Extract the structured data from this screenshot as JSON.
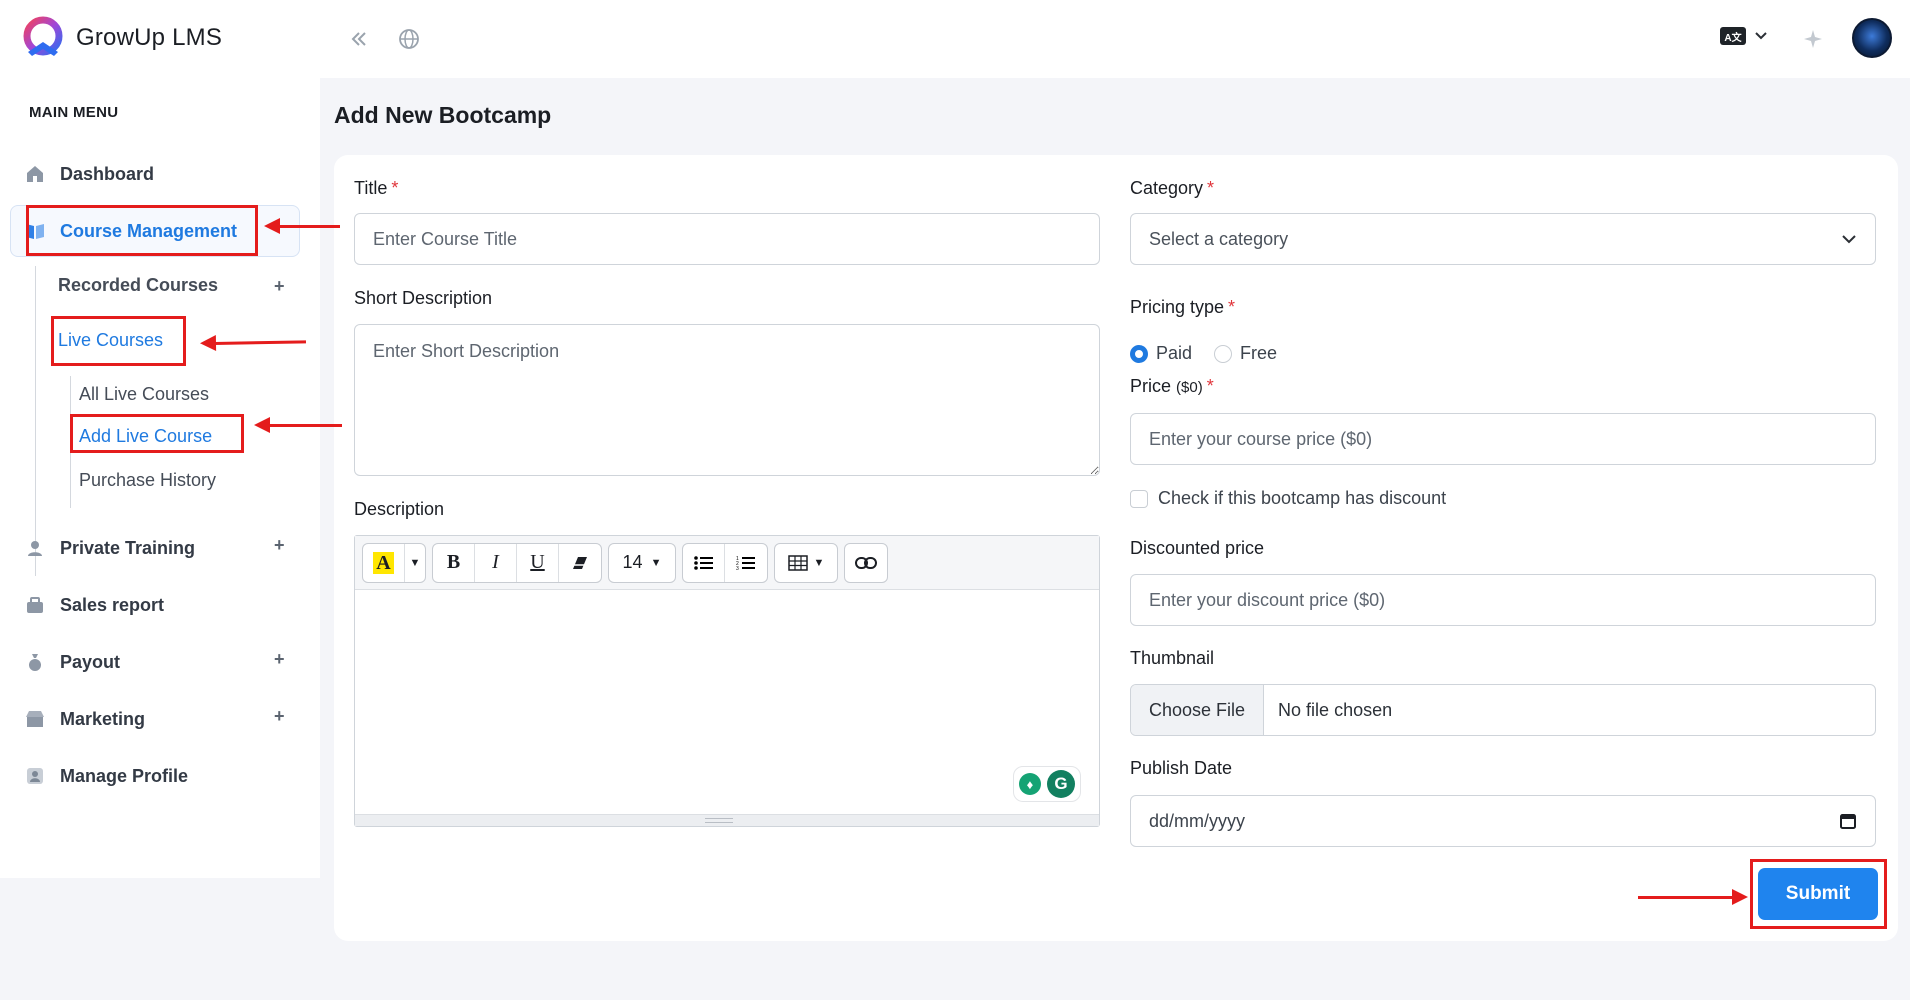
{
  "app": {
    "name": "GrowUp LMS"
  },
  "header": {
    "lang_badge": "A文"
  },
  "sidebar": {
    "menu_title": "MAIN MENU",
    "items": [
      {
        "label": "Dashboard"
      },
      {
        "label": "Course Management"
      },
      {
        "label": "Private Training",
        "expand": "+"
      },
      {
        "label": "Sales report"
      },
      {
        "label": "Payout",
        "expand": "+"
      },
      {
        "label": "Marketing",
        "expand": "+"
      },
      {
        "label": "Manage Profile"
      }
    ],
    "course_management": {
      "recorded_courses": "Recorded Courses",
      "recorded_expand": "+",
      "live_courses": "Live Courses",
      "live_children": [
        "All Live Courses",
        "Add Live Course",
        "Purchase History"
      ]
    }
  },
  "page": {
    "title": "Add New Bootcamp"
  },
  "form": {
    "title_label": "Title",
    "title_placeholder": "Enter Course Title",
    "short_desc_label": "Short Description",
    "short_desc_placeholder": "Enter Short Description",
    "description_label": "Description",
    "editor_font_size": "14",
    "category_label": "Category",
    "category_placeholder": "Select a category",
    "pricing_label": "Pricing type",
    "pricing_options": [
      "Paid",
      "Free"
    ],
    "pricing_selected": "Paid",
    "price_label": "Price",
    "price_unit": "($0)",
    "price_placeholder": "Enter your course price ($0)",
    "discount_check_label": "Check if this bootcamp has discount",
    "discount_label": "Discounted price",
    "discount_placeholder": "Enter your discount price ($0)",
    "thumbnail_label": "Thumbnail",
    "file_button": "Choose File",
    "file_status": "No file chosen",
    "publish_label": "Publish Date",
    "publish_placeholder": "dd/mm/yyyy",
    "submit_label": "Submit",
    "required_mark": "*"
  },
  "colors": {
    "accent": "#1f84ee",
    "annotation": "#e41c1c",
    "required": "#e0353b"
  }
}
